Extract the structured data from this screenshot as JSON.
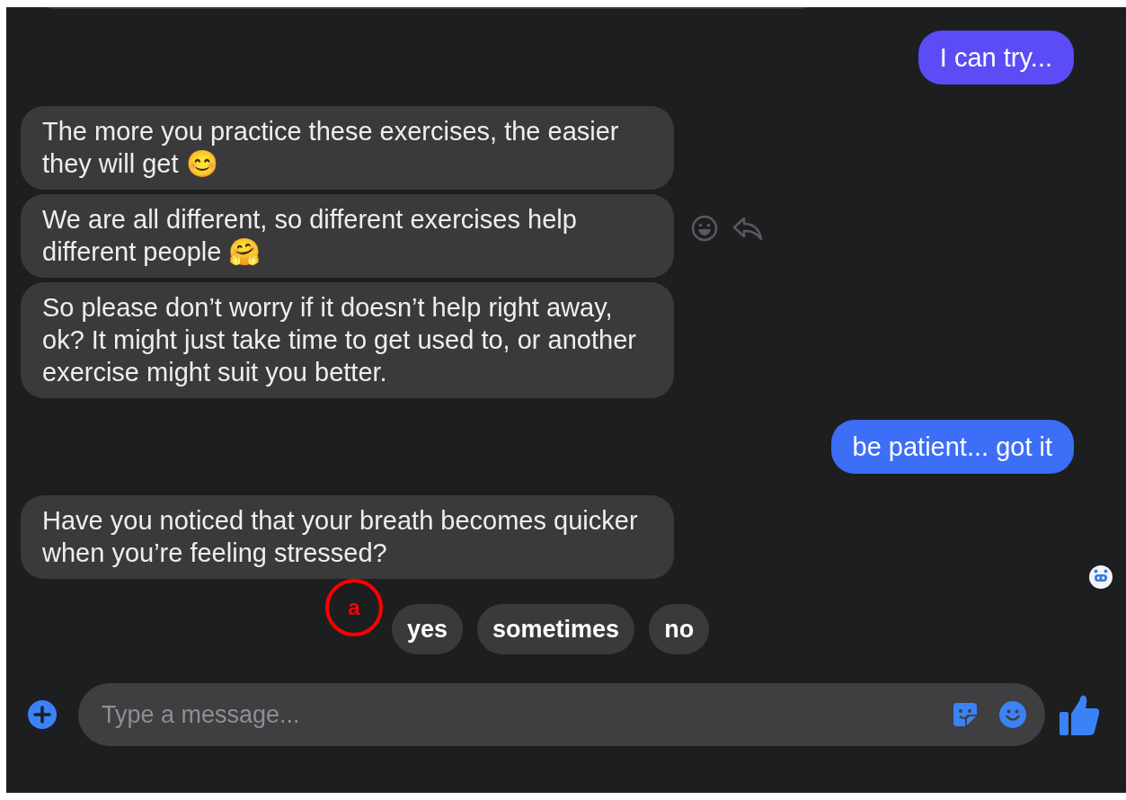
{
  "messages": [
    {
      "kind": "sent",
      "text": "I can try...",
      "color": "#5b4cf5"
    },
    {
      "kind": "received",
      "text": "The more you practice these exercises, the easier they will get 😊",
      "hovered": false,
      "seen": false
    },
    {
      "kind": "received",
      "text": "We are all different, so different exercises help different people 🤗",
      "hovered": true,
      "seen": false
    },
    {
      "kind": "received",
      "text": "So please don’t worry if it doesn’t help right away, ok? It might just take time to get used to, or another exercise might suit you better.",
      "hovered": false,
      "seen": false
    },
    {
      "kind": "sent",
      "text": "be patient... got it",
      "color": "#3d6ef6"
    },
    {
      "kind": "received",
      "text": "Have you noticed that your breath becomes quicker when you’re feeling stressed?",
      "hovered": false,
      "seen": true
    }
  ],
  "quick_replies": [
    "yes",
    "sometimes",
    "no"
  ],
  "annotation": {
    "label": "a"
  },
  "composer": {
    "placeholder": "Type a message..."
  }
}
